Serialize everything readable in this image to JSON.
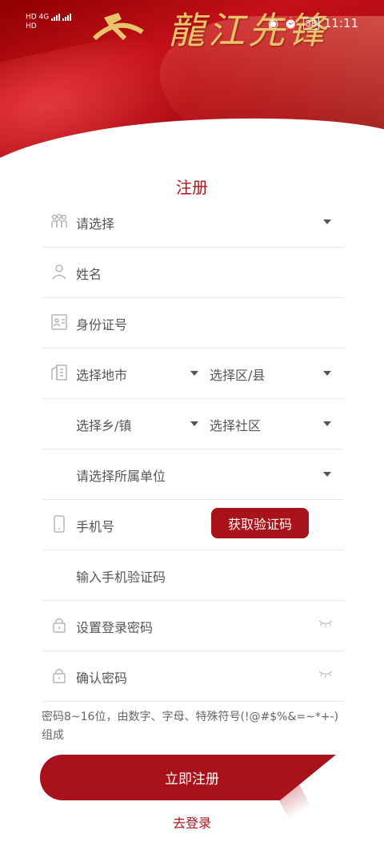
{
  "status_bar": {
    "left_top": "HD 4G",
    "left_bottom": "HD",
    "battery": "88",
    "time": "11:11"
  },
  "header": {
    "banner_text": "龍江先锋"
  },
  "form": {
    "title": "注册",
    "org_select": "请选择",
    "name_placeholder": "姓名",
    "id_placeholder": "身份证号",
    "city_select": "选择地市",
    "district_select": "选择区/县",
    "town_select": "选择乡/镇",
    "community_select": "选择社区",
    "unit_select": "请选择所属单位",
    "phone_placeholder": "手机号",
    "get_code_button": "获取验证码",
    "sms_code_placeholder": "输入手机验证码",
    "password_placeholder": "设置登录密码",
    "confirm_password_placeholder": "确认密码",
    "password_hint": "密码8~16位，由数字、字母、特殊符号(!@#$%&=~*+-)组成",
    "submit_button": "立即注册",
    "login_link": "去登录"
  },
  "colors": {
    "brand_red": "#a8121a",
    "title_red": "#b1141d"
  }
}
